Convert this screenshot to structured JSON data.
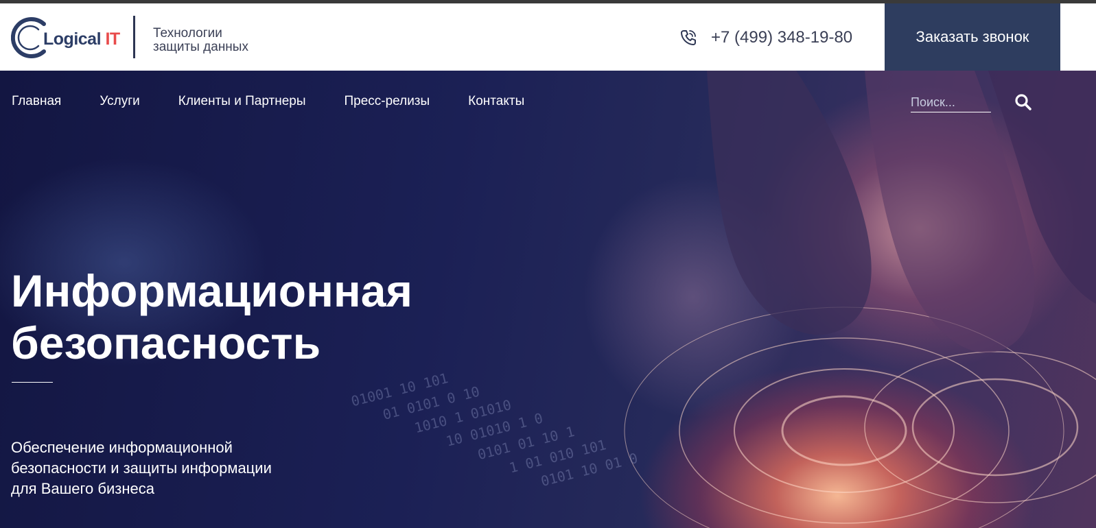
{
  "header": {
    "logo_text": "Logical",
    "logo_accent": "IT",
    "tagline_line1": "Технологии",
    "tagline_line2": "защиты данных",
    "phone": "+7 (499) 348-19-80",
    "callback_label": "Заказать звонок"
  },
  "nav": {
    "items": [
      "Главная",
      "Услуги",
      "Клиенты и Партнеры",
      "Пресс-релизы",
      "Контакты"
    ]
  },
  "search": {
    "placeholder": "Поиск..."
  },
  "hero": {
    "title_line1": "Информационная",
    "title_line2": "безопасность",
    "subtitle_line1": "Обеспечение информационной",
    "subtitle_line2": "безопасности и защиты информации",
    "subtitle_line3": "для Вашего бизнеса"
  },
  "colors": {
    "header_bg": "#ffffff",
    "callback_bg": "#2e3d5f",
    "logo_dark": "#2c3d66",
    "logo_accent": "#e84b4b",
    "hero_bg": "#1b1f45",
    "hero_glow": "#ffb090"
  },
  "icons": {
    "logo": "logo-c-mark",
    "phone": "phone-icon",
    "search": "search-icon"
  }
}
